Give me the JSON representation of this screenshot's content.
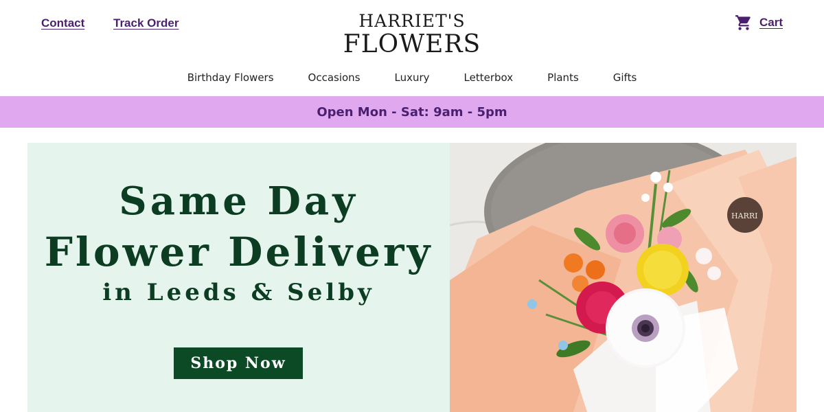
{
  "header": {
    "contact_label": "Contact",
    "track_order_label": "Track Order",
    "cart_label": "Cart",
    "cart_icon": "cart-icon",
    "logo_line1": "HARRIET'S",
    "logo_line2": "FLOWERS"
  },
  "nav": {
    "items": [
      "Birthday Flowers",
      "Occasions",
      "Luxury",
      "Letterbox",
      "Plants",
      "Gifts"
    ]
  },
  "banner": {
    "text": "Open Mon - Sat: 9am - 5pm"
  },
  "hero": {
    "title_line1": "Same Day",
    "title_line2": "Flower Delivery",
    "title_line3": "in Leeds & Selby",
    "cta_label": "Shop Now",
    "image_tag_text": "HARRI"
  },
  "colors": {
    "brand_purple": "#4b1f6f",
    "banner_bg": "#dfa8ef",
    "hero_bg": "#e5f5ee",
    "hero_text": "#0c3d22",
    "cta_bg": "#0c4a25"
  }
}
